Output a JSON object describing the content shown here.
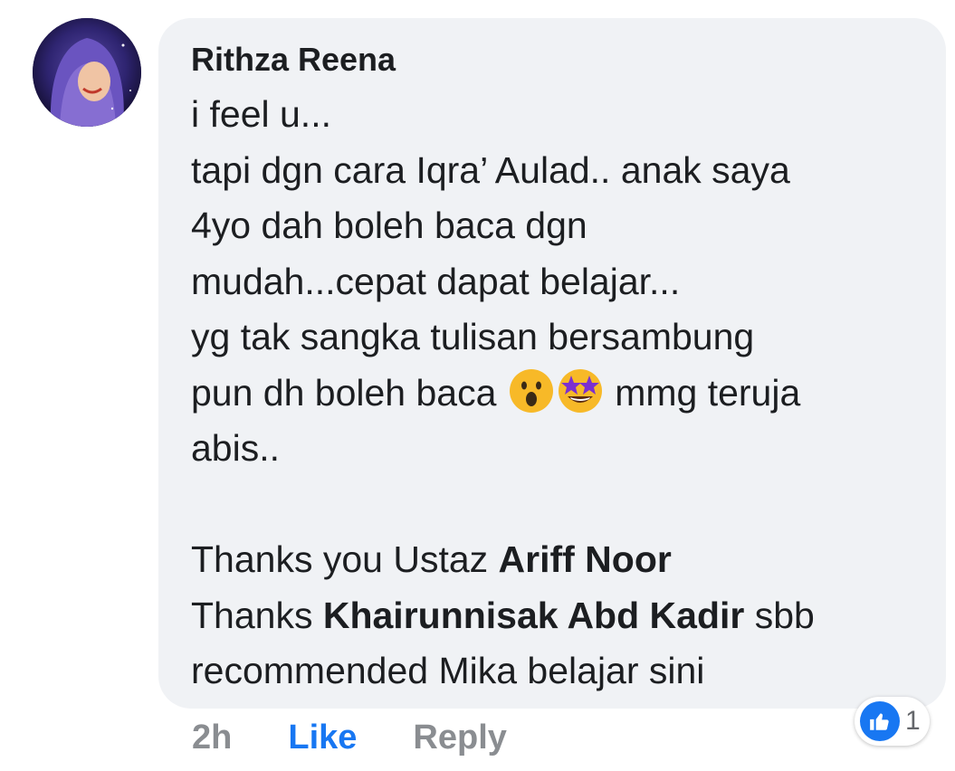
{
  "comment": {
    "author": "Rithza Reena",
    "lines": [
      [
        {
          "t": "i feel u..."
        }
      ],
      [
        {
          "t": "tapi dgn cara Iqra’ Aulad.. anak saya"
        }
      ],
      [
        {
          "t": "4yo dah boleh baca dgn"
        }
      ],
      [
        {
          "t": "mudah...cepat dapat belajar..."
        }
      ],
      [
        {
          "t": "yg tak sangka tulisan bersambung"
        }
      ],
      [
        {
          "t": "pun dh boleh baca "
        },
        {
          "emoji": "surprised-face-emoji"
        },
        {
          "emoji": "star-struck-emoji"
        },
        {
          "t": " mmg teruja"
        }
      ],
      [
        {
          "t": "abis.."
        }
      ],
      [
        {
          "t": ""
        }
      ],
      [
        {
          "t": "Thanks you Ustaz "
        },
        {
          "t": "Ariff Noor",
          "bold": true
        }
      ],
      [
        {
          "t": "Thanks "
        },
        {
          "t": "Khairunnisak Abd Kadir",
          "bold": true
        },
        {
          "t": " sbb"
        }
      ],
      [
        {
          "t": "recommended Mika belajar sini"
        }
      ]
    ]
  },
  "actions": {
    "time": "2h",
    "like_label": "Like",
    "reply_label": "Reply"
  },
  "reactions": {
    "icon": "thumbs-up-icon",
    "count": "1"
  },
  "colors": {
    "bubble": "#f0f2f5",
    "text": "#1c1e21",
    "like": "#1877f2",
    "muted": "#8a8d91"
  }
}
